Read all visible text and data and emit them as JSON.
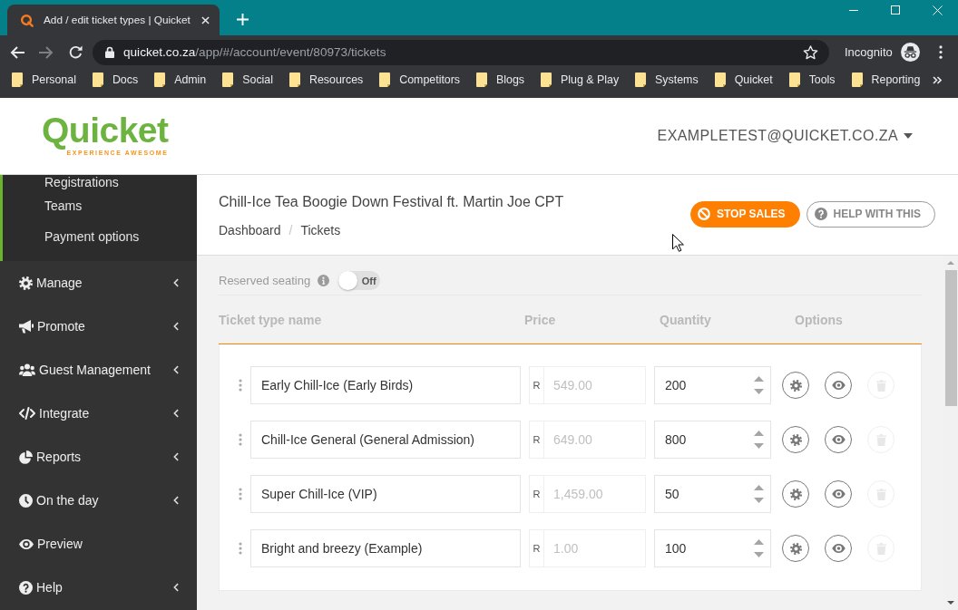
{
  "browser": {
    "tab_title": "Add / edit ticket types | Quicket",
    "forward_disabled": true,
    "url": {
      "host": "quicket.co.za",
      "path": "/app/#/account/event/80973/tickets"
    },
    "profile_label": "Incognito",
    "bookmarks": [
      "Personal",
      "Docs",
      "Admin",
      "Social",
      "Resources",
      "Competitors",
      "Blogs",
      "Plug & Play",
      "Systems",
      "Quicket",
      "Tools",
      "Reporting"
    ]
  },
  "header": {
    "logo": "Quicket",
    "tagline": "EXPERIENCE AWESOME",
    "account": "EXAMPLETEST@QUICKET.CO.ZA"
  },
  "sidebar": {
    "submenu": [
      "Registrations",
      "Teams",
      "Payment options"
    ],
    "items": [
      {
        "label": "Manage",
        "has_submenu": true
      },
      {
        "label": "Promote",
        "has_submenu": true
      },
      {
        "label": "Guest Management",
        "has_submenu": true
      },
      {
        "label": "Integrate",
        "has_submenu": true
      },
      {
        "label": "Reports",
        "has_submenu": true
      },
      {
        "label": "On the day",
        "has_submenu": true
      },
      {
        "label": "Preview",
        "has_submenu": false
      },
      {
        "label": "Help",
        "has_submenu": true
      }
    ]
  },
  "page": {
    "title": "Chill-Ice Tea Boogie Down Festival ft. Martin Joe CPT",
    "breadcrumb": {
      "items": [
        "Dashboard",
        "Tickets"
      ],
      "separator": "/"
    },
    "buttons": [
      {
        "label": "STOP SALES",
        "kind": "stop"
      },
      {
        "label": "HELP WITH THIS",
        "kind": "help"
      }
    ]
  },
  "tickets": {
    "reserved_seating": {
      "label": "Reserved seating",
      "on": false,
      "switch_text": "Off"
    },
    "columns": [
      "Ticket type name",
      "Price",
      "Quantity",
      "Options"
    ],
    "rows": [
      {
        "name": "Early Chill-Ice (Early Birds)",
        "currency": "R",
        "price": "549.00",
        "price_disabled": true,
        "quantity": "200",
        "delete_disabled": true
      },
      {
        "name": "Chill-Ice General (General Admission)",
        "currency": "R",
        "price": "649.00",
        "price_disabled": true,
        "quantity": "800",
        "delete_disabled": true
      },
      {
        "name": "Super Chill-Ice (VIP)",
        "currency": "R",
        "price": "1,459.00",
        "price_disabled": true,
        "quantity": "50",
        "delete_disabled": true
      },
      {
        "name": "Bright and breezy (Example)",
        "currency": "R",
        "price": "1.00",
        "price_disabled": true,
        "quantity": "100",
        "delete_disabled": true
      }
    ]
  }
}
